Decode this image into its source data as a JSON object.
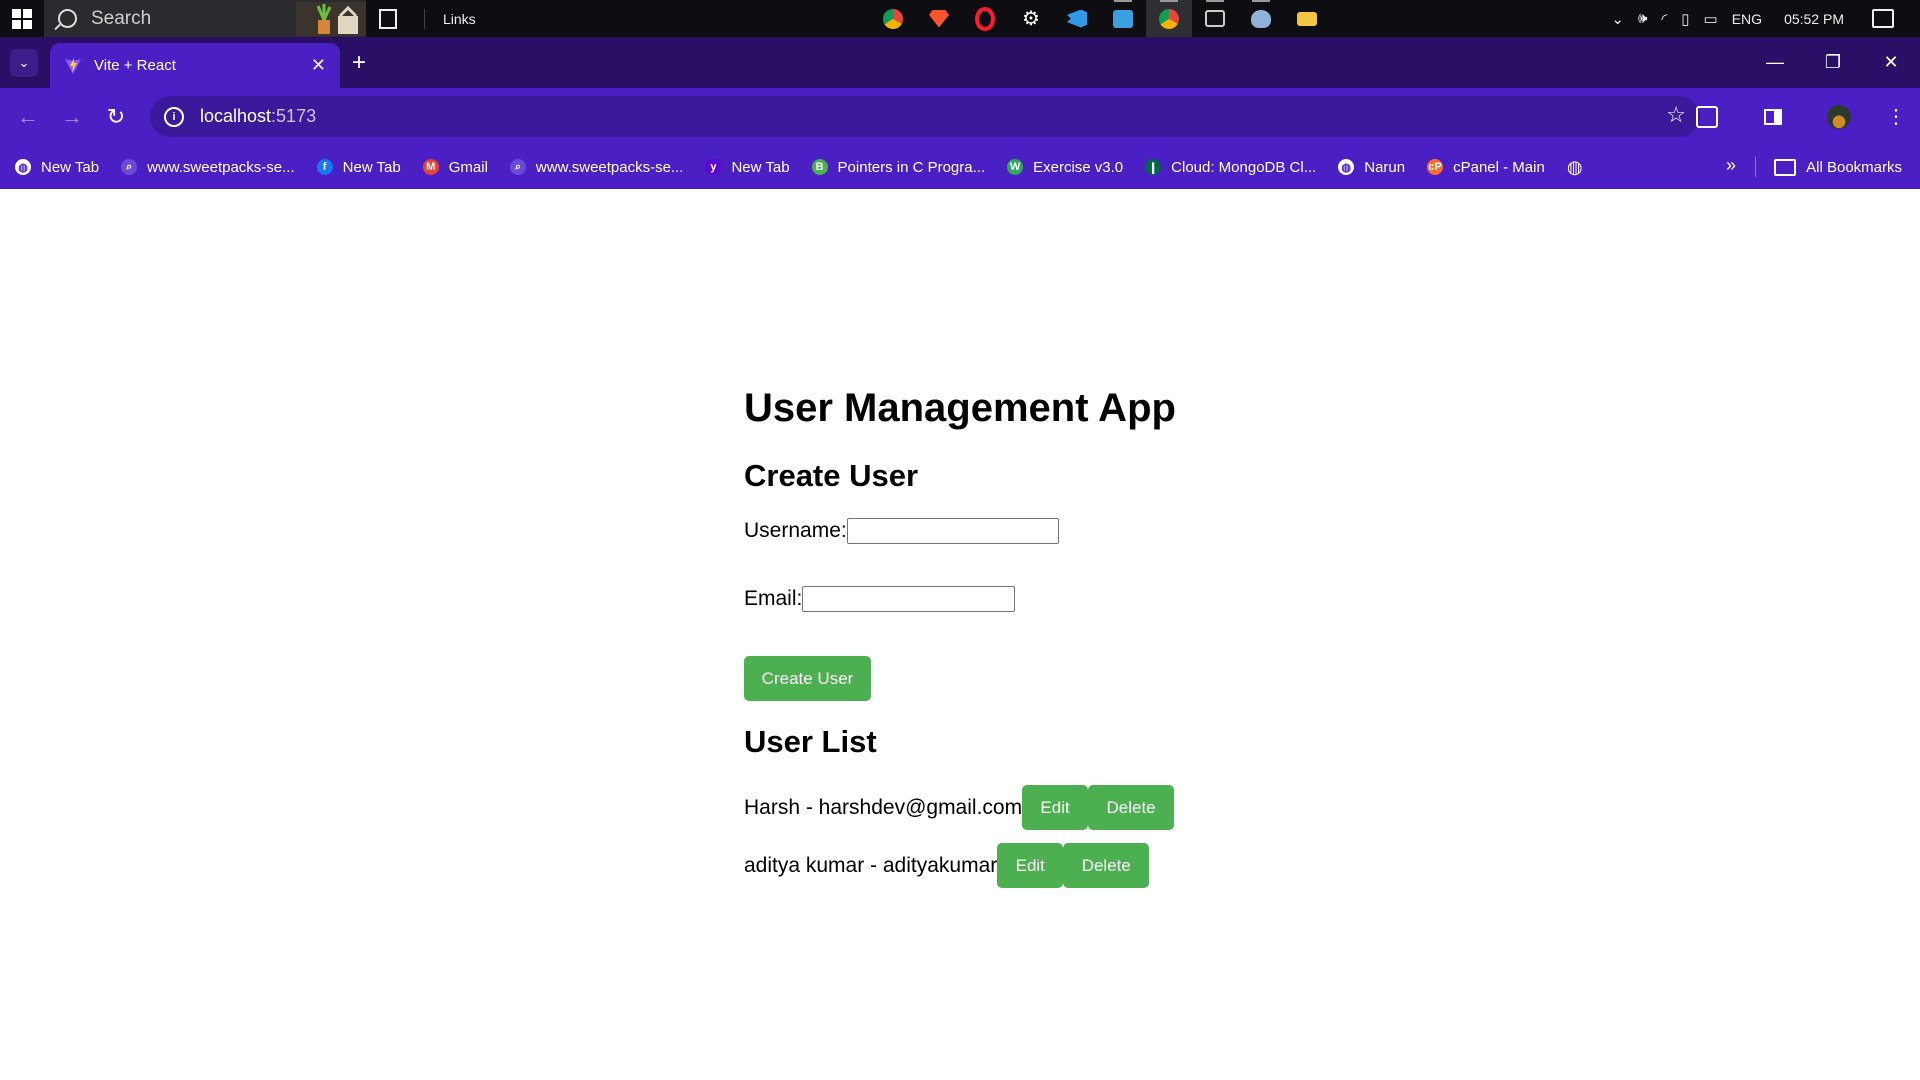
{
  "taskbar": {
    "search_label": "Search",
    "links_label": "Links",
    "apps": [
      {
        "name": "chrome-icon",
        "color": "#e8453c"
      },
      {
        "name": "brave-icon",
        "color": "#fb542b"
      },
      {
        "name": "opera-icon",
        "color": "#ff1b2d"
      },
      {
        "name": "settings-icon",
        "color": "#ffffff"
      },
      {
        "name": "vscode-icon",
        "color": "#2f9be8"
      },
      {
        "name": "app-icon",
        "color": "#3aa0e0"
      },
      {
        "name": "chrome-active-icon",
        "color": "#e8453c"
      },
      {
        "name": "terminal-icon",
        "color": "#cccccc"
      },
      {
        "name": "postgres-icon",
        "color": "#8fb3d9"
      },
      {
        "name": "file-explorer-icon",
        "color": "#f5c542"
      }
    ],
    "language": "ENG",
    "time": "05:52 PM"
  },
  "browser": {
    "tab_title": "Vite + React",
    "url_host": "localhost",
    "url_port": ":5173",
    "bookmarks": [
      {
        "label": "New Tab",
        "icon": "globe-icon",
        "color": "#ffffff"
      },
      {
        "label": "www.sweetpacks-se...",
        "icon": "search-icon",
        "color": "#6a4bd8"
      },
      {
        "label": "New Tab",
        "icon": "facebook-icon",
        "color": "#1877f2"
      },
      {
        "label": "Gmail",
        "icon": "gmail-icon",
        "color": "#ea4335"
      },
      {
        "label": "www.sweetpacks-se...",
        "icon": "search-icon",
        "color": "#6a4bd8"
      },
      {
        "label": "New Tab",
        "icon": "yahoo-icon",
        "color": "#6001d2"
      },
      {
        "label": "Pointers in C Progra...",
        "icon": "b-icon",
        "color": "#4caf50"
      },
      {
        "label": "Exercise v3.0",
        "icon": "w-icon",
        "color": "#2eaa5a"
      },
      {
        "label": "Cloud: MongoDB Cl...",
        "icon": "mongodb-icon",
        "color": "#00684a"
      },
      {
        "label": "Narun",
        "icon": "globe-icon",
        "color": "#ffffff"
      },
      {
        "label": "cPanel - Main",
        "icon": "cpanel-icon",
        "color": "#ff6c2c"
      }
    ],
    "all_bookmarks_label": "All Bookmarks"
  },
  "page": {
    "title": "User Management App",
    "create_heading": "Create User",
    "username_label": "Username:",
    "username_value": "",
    "email_label": "Email:",
    "email_value": "",
    "create_button": "Create User",
    "list_heading": "User List",
    "users": [
      {
        "text": "Harsh - harshdev@gmail.com",
        "edit": "Edit",
        "delete": "Delete"
      },
      {
        "text": "aditya kumar - adityakumar",
        "edit": "Edit",
        "delete": "Delete"
      }
    ]
  },
  "colors": {
    "button_green": "#4caf50",
    "tabstrip": "#2a0f66",
    "toolbar": "#4a1fc4"
  }
}
